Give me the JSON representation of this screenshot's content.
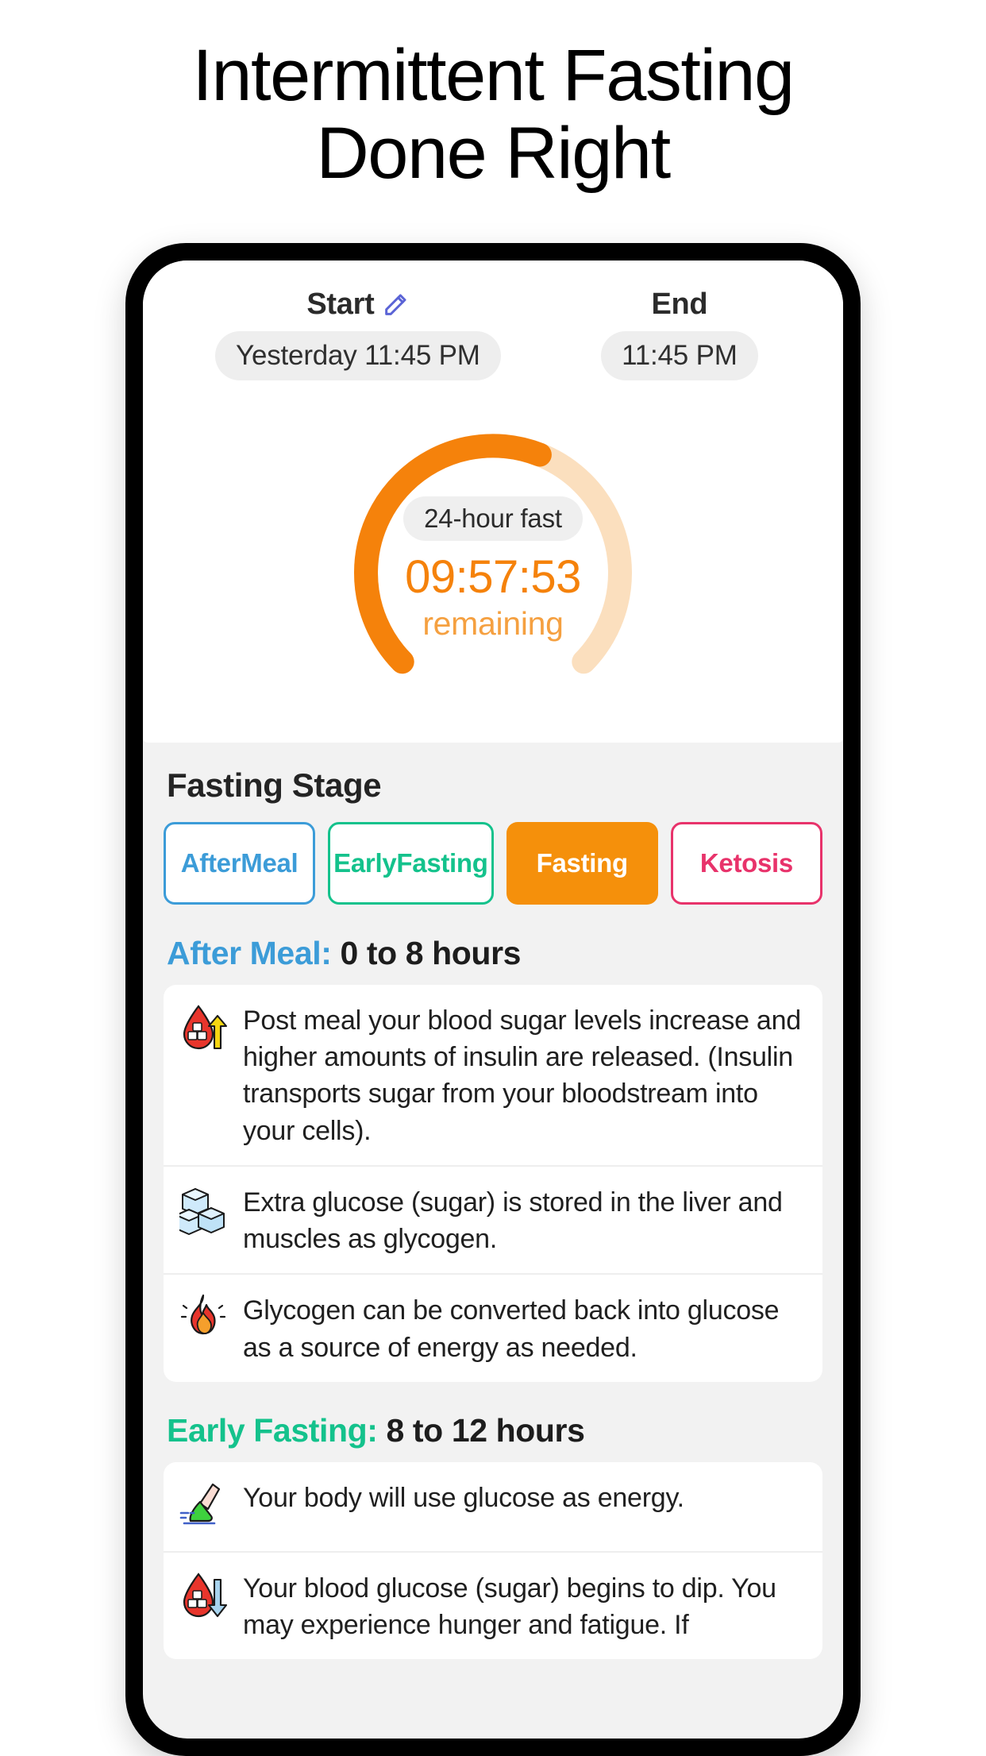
{
  "headline": {
    "line1": "Intermittent Fasting",
    "line2": "Done Right"
  },
  "colors": {
    "orange": "#f5820b",
    "orange_track": "#fbdfbe",
    "orange_sub": "#f5a040",
    "blue": "#3c9cd8",
    "green": "#14c28c",
    "pink": "#e8336b",
    "screen_bg": "#f2f2f2",
    "card_bg": "#ffffff"
  },
  "timer": {
    "start": {
      "label": "Start",
      "edit_icon": "pencil-icon",
      "value": "Yesterday 11:45 PM"
    },
    "end": {
      "label": "End",
      "value": "11:45 PM"
    },
    "fast_type": "24-hour fast",
    "remaining_value": "09:57:53",
    "remaining_label": "remaining",
    "progress_percent": 58
  },
  "fasting_stage": {
    "title": "Fasting Stage",
    "chips": [
      {
        "label": "After\nMeal",
        "color": "#3c9cd8",
        "selected": false
      },
      {
        "label": "Early\nFasting",
        "color": "#14c28c",
        "selected": false
      },
      {
        "label": "Fasting",
        "color": "#f5900b",
        "selected": true
      },
      {
        "label": "Ketosis",
        "color": "#e8336b",
        "selected": false
      }
    ]
  },
  "sections": [
    {
      "name": "After Meal",
      "name_color": "#3c9cd8",
      "range": "0 to 8 hours",
      "rows": [
        {
          "icon": "blood-drop-sugar-up-icon",
          "text": "Post meal your blood sugar levels increase and higher amounts of insulin are released. (Insulin transports sugar from your bloodstream into your cells)."
        },
        {
          "icon": "sugar-cubes-icon",
          "text": "Extra glucose (sugar) is stored in the liver and muscles as glycogen."
        },
        {
          "icon": "flame-icon",
          "text": "Glycogen can be converted back into glucose as a source of energy as needed."
        }
      ]
    },
    {
      "name": "Early Fasting",
      "name_color": "#14c28c",
      "range": "8 to 12 hours",
      "rows": [
        {
          "icon": "running-leg-icon",
          "text": "Your body will use glucose as energy."
        },
        {
          "icon": "blood-drop-sugar-down-icon",
          "text": "Your blood glucose (sugar) begins to dip. You may experience hunger and fatigue. If"
        }
      ]
    }
  ]
}
